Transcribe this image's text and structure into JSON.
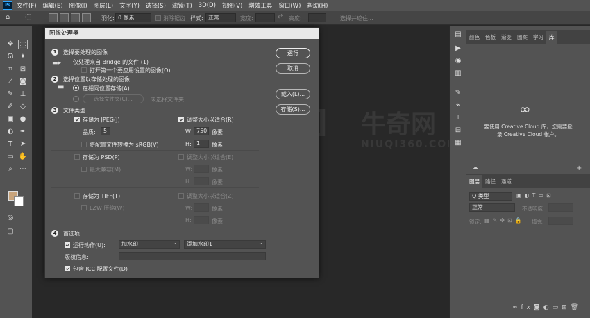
{
  "menu": {
    "logo": "Ps",
    "items": [
      "文件(F)",
      "编辑(E)",
      "图像(I)",
      "图层(L)",
      "文字(Y)",
      "选择(S)",
      "滤镜(T)",
      "3D(D)",
      "视图(V)",
      "增效工具",
      "窗口(W)",
      "帮助(H)"
    ]
  },
  "options": {
    "feather_label": "羽化:",
    "feather_value": "0 像素",
    "antialias": "消除锯齿",
    "style_label": "样式:",
    "style_value": "正常",
    "width_label": "宽度:",
    "height_label": "高度:",
    "select_mask": "选择并遮住..."
  },
  "dialog": {
    "title": "图像处理器",
    "section1": {
      "num": "1",
      "title": "选择要处理的图像",
      "source": "仅处理来自 Bridge 的文件 (1)",
      "open_first": "打开第一个要应用设置的图像(O)"
    },
    "section2": {
      "num": "2",
      "title": "选择位置以存储处理的图像",
      "same_location": "在相同位置存储(A)",
      "choose_folder": "选择文件夹(C)...",
      "no_folder": "未选择文件夹"
    },
    "section3": {
      "num": "3",
      "title": "文件类型",
      "jpeg": "存储为 JPEG(J)",
      "quality_label": "品质:",
      "quality_value": "5",
      "convert_srgb": "将配置文件转换为 sRGB(V)",
      "resize_jpeg": "调整大小以适合(R)",
      "w_label": "W:",
      "w_value": "750",
      "h_label": "H:",
      "h_value": "1",
      "unit": "像素",
      "psd": "存储为 PSD(P)",
      "max_compat": "最大兼容(M)",
      "resize_psd": "调整大小以适合(E)",
      "tiff": "存储为 TIFF(T)",
      "lzw": "LZW 压缩(W)",
      "resize_tiff": "调整大小以适合(Z)"
    },
    "section4": {
      "num": "4",
      "title": "首选项",
      "run_action": "运行动作(U):",
      "action_set": "加水印",
      "action_name": "添加水印1",
      "copyright": "版权信息:",
      "include_icc": "包含 ICC 配置文件(D)"
    },
    "buttons": {
      "run": "运行",
      "cancel": "取消",
      "load": "载入(L)...",
      "save": "存储(S)..."
    }
  },
  "right_panel": {
    "tabs_top": [
      "颜色",
      "色板",
      "渐变",
      "图案",
      "学习",
      "库"
    ],
    "cc_line1": "要使用 Creative Cloud 库，您需要登",
    "cc_line2": "录 Creative Cloud 帐户。",
    "layers_tabs": [
      "图层",
      "路径",
      "通道"
    ],
    "kind": "Q 类型",
    "blend": "正常",
    "opacity": "不透明度:",
    "lock": "锁定:",
    "fill": "填充:"
  },
  "watermark": {
    "brand": "牛奇网",
    "url": "NIUQI360.COM"
  }
}
